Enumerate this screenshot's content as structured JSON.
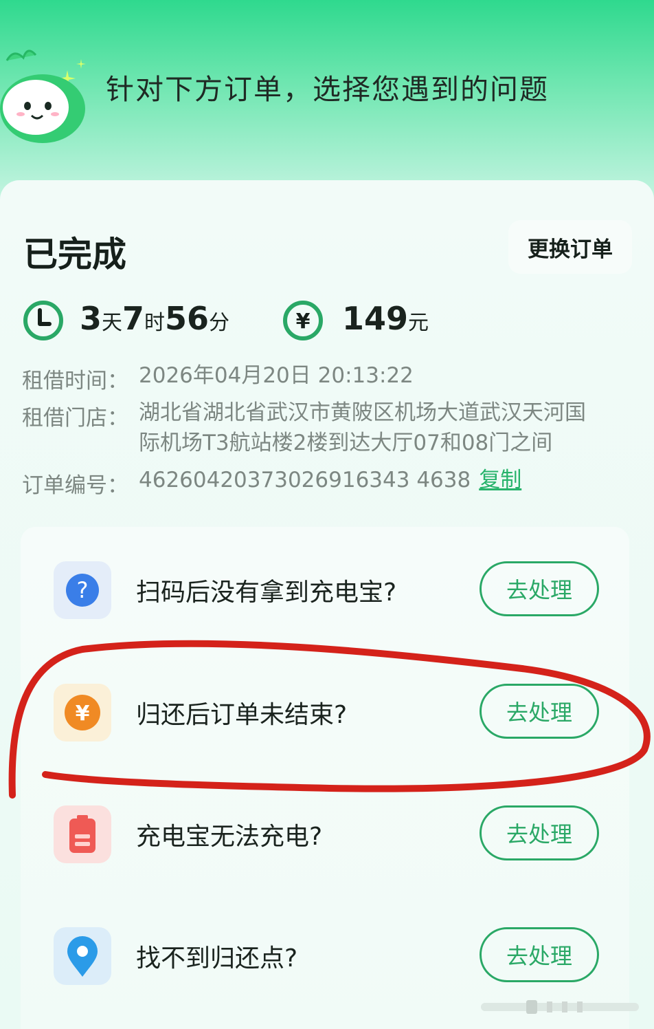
{
  "header": {
    "title": "针对下方订单，选择您遇到的问题"
  },
  "order": {
    "status": "已完成",
    "switch_label": "更换订单",
    "duration": {
      "days": "3",
      "days_unit": "天",
      "hours": "7",
      "hours_unit": "时",
      "minutes": "56",
      "minutes_unit": "分"
    },
    "price": {
      "amount": "149",
      "unit": "元"
    },
    "rent_time_label": "租借时间：",
    "rent_time_value": "2026年04月20日 20:13:22",
    "store_label": "租借门店：",
    "store_value_line1": "湖北省湖北省武汉市黄陂区机场大道武汉天河国",
    "store_value_line2": "际机场T3航站楼2楼到达大厅07和08门之间",
    "order_no_label": "订单编号：",
    "order_no_value": "46260420373026916343 4638",
    "copy_label": "复制"
  },
  "issues": [
    {
      "label": "扫码后没有拿到充电宝?",
      "action": "去处理",
      "icon": "question-icon",
      "color": "#3a7ee8"
    },
    {
      "label": "归还后订单未结束?",
      "action": "去处理",
      "icon": "yuan-icon",
      "color": "#f08a24"
    },
    {
      "label": "充电宝无法充电?",
      "action": "去处理",
      "icon": "battery-icon",
      "color": "#ef5a55"
    },
    {
      "label": "找不到归还点?",
      "action": "去处理",
      "icon": "location-pin-icon",
      "color": "#2b9be8"
    }
  ],
  "colors": {
    "accent": "#2aa866",
    "annotation": "#d4221a"
  }
}
